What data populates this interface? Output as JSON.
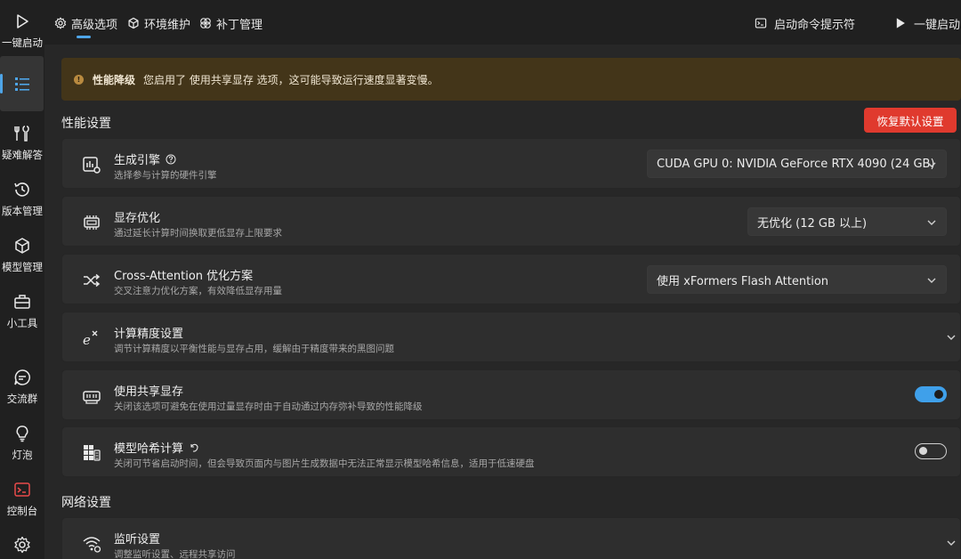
{
  "sidebar": {
    "items": [
      {
        "label": "一键启动",
        "icon": "play-icon"
      },
      {
        "label": "",
        "icon": "list-icon"
      },
      {
        "label": "疑难解答",
        "icon": "tools-icon"
      },
      {
        "label": "版本管理",
        "icon": "history-icon"
      },
      {
        "label": "模型管理",
        "icon": "cube-icon"
      },
      {
        "label": "小工具",
        "icon": "toolbox-icon"
      },
      {
        "label": "交流群",
        "icon": "chat-icon"
      },
      {
        "label": "灯泡",
        "icon": "bulb-icon"
      },
      {
        "label": "控制台",
        "icon": "console-icon"
      },
      {
        "label": "",
        "icon": "gear-icon"
      }
    ]
  },
  "topbar": {
    "tabs": [
      {
        "label": "高级选项",
        "icon": "gear-icon"
      },
      {
        "label": "环境维护",
        "icon": "cube-icon"
      },
      {
        "label": "补丁管理",
        "icon": "patch-icon"
      }
    ],
    "actions": [
      {
        "label": "启动命令提示符",
        "icon": "terminal-icon"
      },
      {
        "label": "一键启动",
        "icon": "play-icon"
      }
    ]
  },
  "warning": {
    "title": "性能降级",
    "message": "您启用了 使用共享显存 选项，这可能导致运行速度显著变慢。"
  },
  "performance": {
    "section_title": "性能设置",
    "reset_label": "恢复默认设置",
    "engine": {
      "title": "生成引擎",
      "desc": "选择参与计算的硬件引擎",
      "value": "CUDA GPU 0: NVIDIA GeForce RTX 4090 (24 GB)"
    },
    "vram": {
      "title": "显存优化",
      "desc": "通过延长计算时间换取更低显存上限要求",
      "value": "无优化 (12 GB 以上)"
    },
    "attention": {
      "title": "Cross-Attention 优化方案",
      "desc": "交叉注意力优化方案，有效降低显存用量",
      "value": "使用 xFormers Flash Attention"
    },
    "precision": {
      "title": "计算精度设置",
      "desc": "调节计算精度以平衡性能与显存占用，缓解由于精度带来的黑图问题"
    },
    "shared_vram": {
      "title": "使用共享显存",
      "desc": "关闭该选项可避免在使用过量显存时由于自动通过内存弥补导致的性能降级",
      "enabled": true
    },
    "model_hash": {
      "title": "模型哈希计算",
      "desc": "关闭可节省启动时间，但会导致页面内与图片生成数据中无法正常显示模型哈希信息，适用于低速硬盘",
      "enabled": false
    }
  },
  "network": {
    "section_title": "网络设置",
    "listen": {
      "title": "监听设置",
      "desc": "调整监听设置、远程共享访问"
    }
  },
  "colors": {
    "accent": "#4ea5e8",
    "danger": "#e03a2e",
    "warning_bg": "#433519"
  }
}
